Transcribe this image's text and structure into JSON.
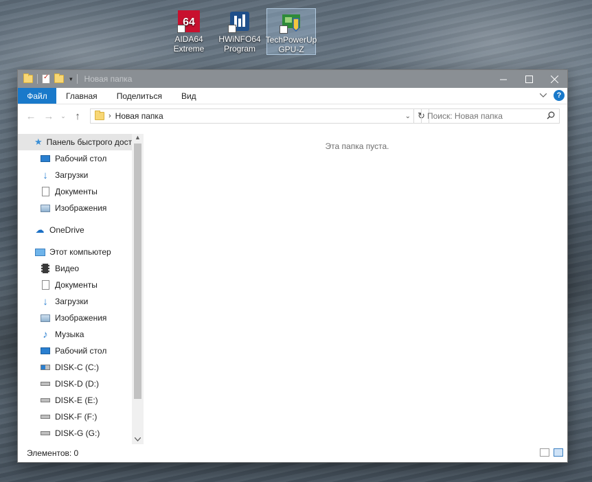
{
  "desktop": {
    "icons": [
      {
        "label": "AIDA64 Extreme",
        "icon": "aida64-icon"
      },
      {
        "label": "HWiNFO64 Program",
        "icon": "hwinfo-icon"
      },
      {
        "label": "TechPowerUp GPU-Z",
        "icon": "gpuz-icon"
      }
    ]
  },
  "window": {
    "title": "Новая папка",
    "ribbon": {
      "tabs": [
        "Файл",
        "Главная",
        "Поделиться",
        "Вид"
      ],
      "help": "?"
    },
    "nav": {
      "back": "←",
      "forward": "→",
      "recent": "⌄",
      "up": "↑"
    },
    "address": {
      "separator": "›",
      "crumb": "Новая папка",
      "dropdown": "⌄",
      "refresh": "↻"
    },
    "search": {
      "placeholder": "Поиск: Новая папка"
    },
    "navpane": {
      "quick_access": "Панель быстрого доступа",
      "quick_items": [
        "Рабочий стол",
        "Загрузки",
        "Документы",
        "Изображения"
      ],
      "onedrive": "OneDrive",
      "this_pc": "Этот компьютер",
      "pc_items": [
        "Видео",
        "Документы",
        "Загрузки",
        "Изображения",
        "Музыка",
        "Рабочий стол"
      ],
      "drives": [
        "DISK-C (C:)",
        "DISK-D (D:)",
        "DISK-E (E:)",
        "DISK-F (F:)",
        "DISK-G (G:)"
      ]
    },
    "main": {
      "empty_message": "Эта папка пуста."
    },
    "status": {
      "items": "Элементов: 0"
    },
    "colors": {
      "accent": "#1979ca",
      "titlebar": "#8a8f94"
    }
  }
}
